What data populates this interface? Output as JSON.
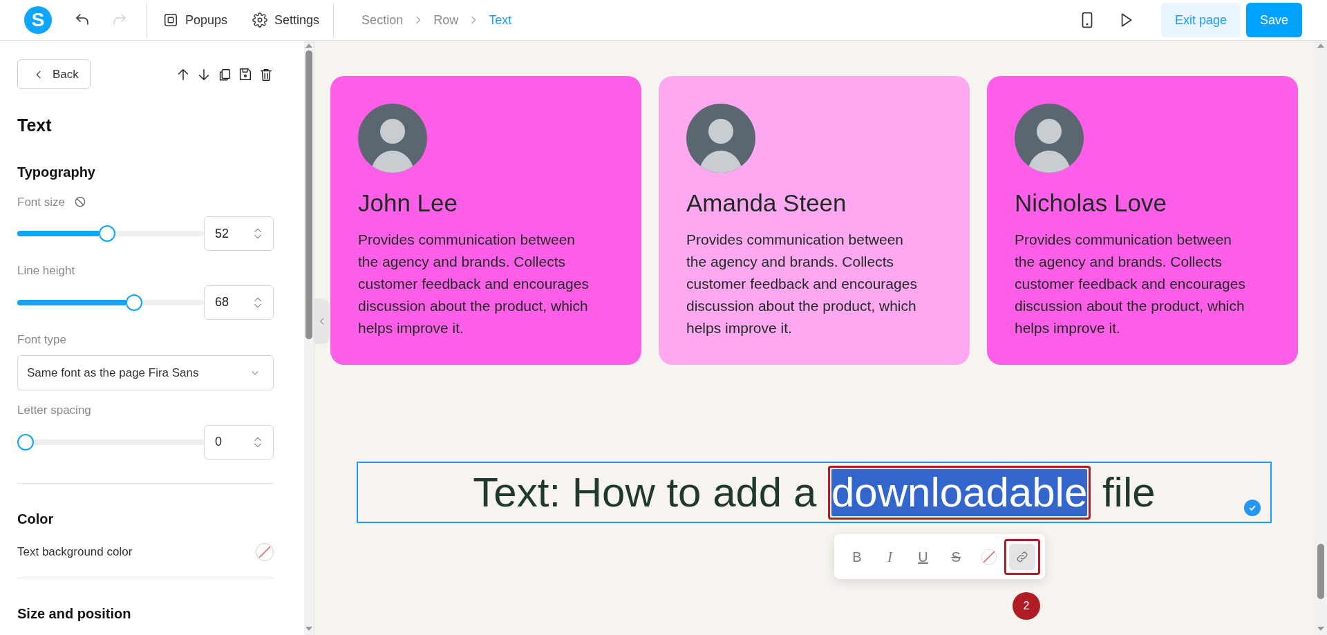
{
  "topbar": {
    "logo": "S",
    "history": [
      {
        "kind": "undo",
        "disabled": false
      },
      {
        "kind": "redo",
        "disabled": true
      }
    ],
    "menu": [
      {
        "kind": "popups",
        "label": "Popups"
      },
      {
        "kind": "settings",
        "label": "Settings"
      }
    ],
    "breadcrumb": [
      {
        "label": "Section",
        "selected": false
      },
      {
        "label": "Row",
        "selected": false
      },
      {
        "label": "Text",
        "selected": true
      }
    ],
    "exit": "Exit page",
    "save": "Save"
  },
  "panel": {
    "back": "Back",
    "title": "Text",
    "sections": [
      {
        "title": "Typography",
        "controls": [
          {
            "kind": "slider",
            "label": "Font size",
            "reset": true,
            "level": 0.48,
            "value": "52"
          },
          {
            "kind": "slider",
            "label": "Line height",
            "reset": false,
            "level": 0.64,
            "value": "68"
          },
          {
            "kind": "select",
            "label": "Font type",
            "value": "Same font as the page Fira Sans"
          },
          {
            "kind": "slider",
            "label": "Letter spacing",
            "reset": false,
            "level": 0,
            "value": "0"
          }
        ]
      },
      {
        "title": "Color",
        "controls": [
          {
            "kind": "swatch",
            "label": "Text background color"
          }
        ]
      },
      {
        "title": "Size and position"
      }
    ]
  },
  "canvas": {
    "cards": [
      {
        "name": "John Lee",
        "description": "Provides communication between the agency and brands. Collects customer feedback and encourages discussion about the product, which helps improve it.",
        "color": "#ff5ee8"
      },
      {
        "name": "Amanda Steen",
        "description": "Provides communication between the agency and brands. Collects customer feedback and encourages discussion about the product, which helps improve it.",
        "color": "#fda8f0"
      },
      {
        "name": "Nicholas Love",
        "description": "Provides communication between the agency and brands. Collects customer feedback and encourages discussion about the product, which helps improve it.",
        "color": "#ff5ee8"
      }
    ],
    "heading": {
      "before": "Text: How to add a ",
      "selection": "downloadable",
      "after": " file",
      "marked": true
    },
    "format_toolbar": [
      {
        "kind": "bold",
        "label": "B",
        "selected": false,
        "marked": false
      },
      {
        "kind": "italic",
        "label": "I",
        "selected": false,
        "marked": false
      },
      {
        "kind": "underline",
        "label": "U",
        "selected": false,
        "marked": false
      },
      {
        "kind": "strike",
        "label": "S",
        "selected": false,
        "marked": false
      },
      {
        "kind": "nocolor",
        "selected": false,
        "marked": false
      },
      {
        "kind": "link",
        "selected": true,
        "marked": true
      }
    ],
    "step_badge": "2"
  }
}
